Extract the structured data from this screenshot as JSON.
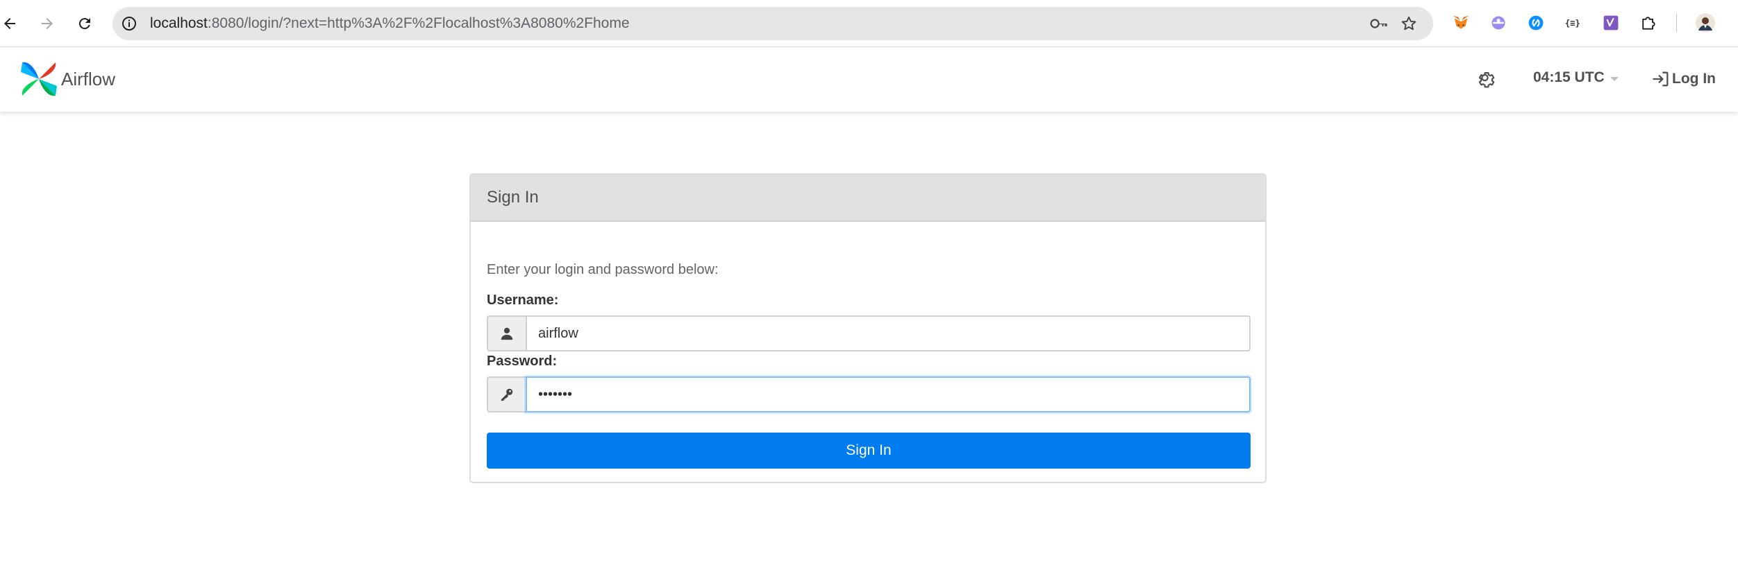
{
  "browser": {
    "url_host": "localhost",
    "url_rest": ":8080/login/?next=http%3A%2F%2Flocalhost%3A8080%2Fhome",
    "extension_icons": [
      "metamask-icon",
      "extension-purple-icon",
      "shazam-icon",
      "json-viewer-icon",
      "vimeo-icon",
      "extensions-puzzle-icon",
      "profile-avatar-icon"
    ]
  },
  "navbar": {
    "brand": "Airflow",
    "clock": "04:15 UTC",
    "login": "Log In"
  },
  "signin": {
    "heading": "Sign In",
    "intro": "Enter your login and password below:",
    "username_label": "Username:",
    "username_value": "airflow",
    "password_label": "Password:",
    "password_value": "airflow",
    "submit": "Sign In"
  },
  "colors": {
    "primary_button": "#017cee",
    "panel_heading": "#e1e1e1"
  }
}
